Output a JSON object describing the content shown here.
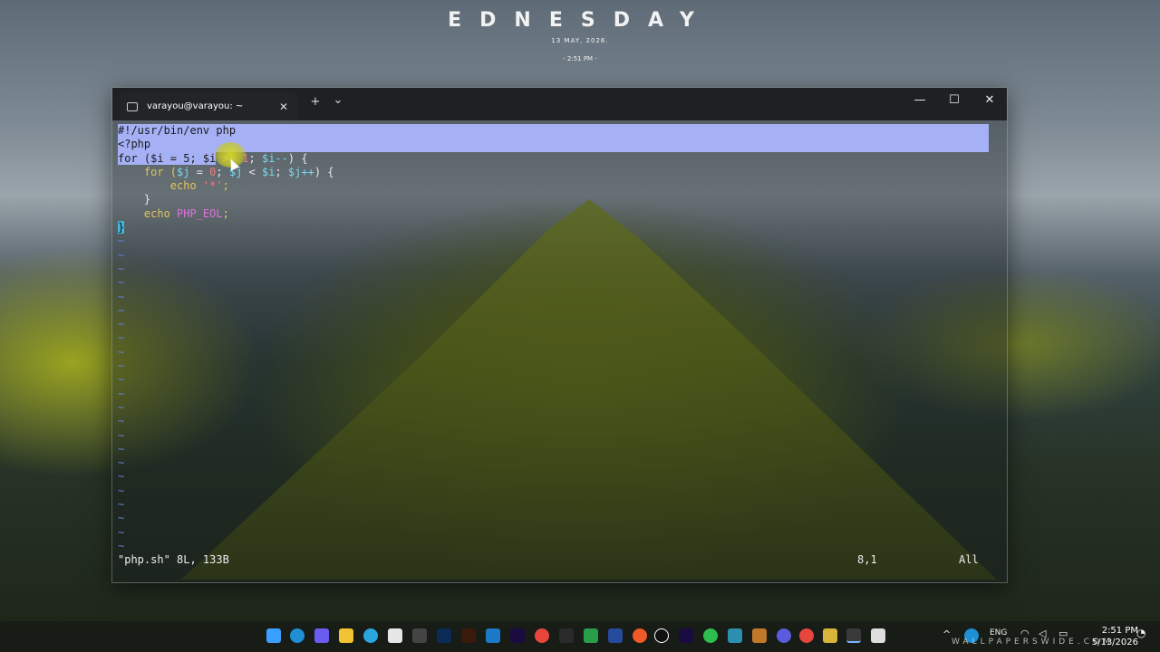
{
  "widget": {
    "day": "EDNESDAY",
    "date": "13 MAY, 2026.",
    "time": "- 2:51 PM -"
  },
  "terminal": {
    "tab_title": "varayou@varayou: ~",
    "tab_close": "✕",
    "new_tab": "+",
    "dropdown": "⌄",
    "minimize": "—",
    "maximize": "☐",
    "close": "✕",
    "code": {
      "l1": "#!/usr/bin/env php",
      "l2": "<?php",
      "l3a": "for ($i = 5; ",
      "l3b": "$i",
      "l3c": " >= ",
      "l3d": "1",
      "l3e": "; ",
      "l3f": "$i--",
      "l3g": ") {",
      "l4a": "    for (",
      "l4b": "$j",
      "l4c": " = ",
      "l4d": "0",
      "l4e": "; ",
      "l4f": "$j",
      "l4g": " < ",
      "l4h": "$i",
      "l4i": "; ",
      "l4j": "$j++",
      "l4k": ") {",
      "l5a": "        echo ",
      "l5b": "'*'",
      "l5c": ";",
      "l6": "    }",
      "l7a": "    echo ",
      "l7b": "PHP_EOL",
      "l7c": ";",
      "l8": "}"
    },
    "tilde": "~",
    "status": {
      "file": "\"php.sh\" 8L, 133B",
      "position": "8,1",
      "scroll": "All"
    }
  },
  "taskbar": {
    "language": "ENG",
    "time": "2:51 PM",
    "date": "5/13/2026"
  },
  "watermark": "WALLPAPERSWIDE.COM"
}
